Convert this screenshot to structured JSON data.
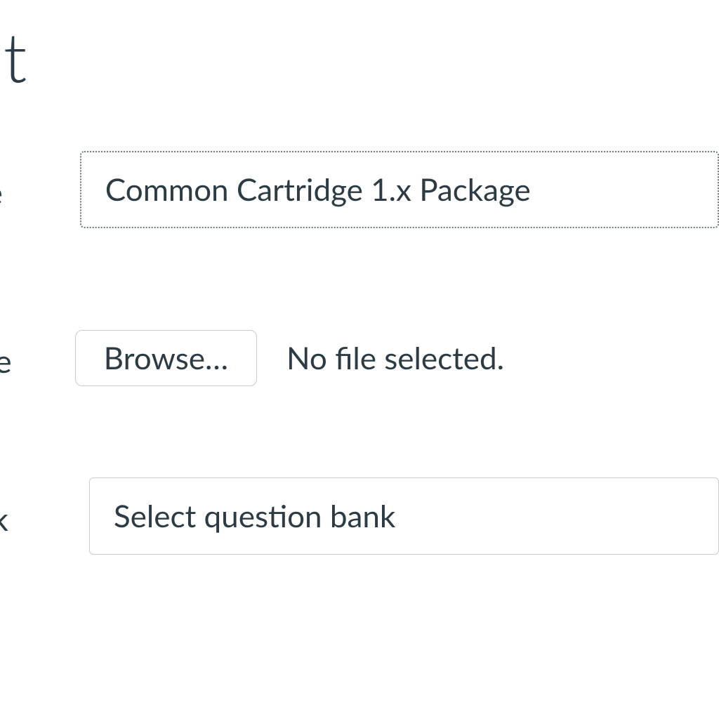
{
  "header": {
    "title_fragment": "tent"
  },
  "form": {
    "type": {
      "label_fragment": "ype",
      "value": "Common Cartridge 1.x Package"
    },
    "source": {
      "label_fragment": "rce",
      "browse_label": "Browse…",
      "status": "No file selected."
    },
    "question_bank": {
      "label_fragment": "ank",
      "placeholder": "Select question bank"
    }
  }
}
